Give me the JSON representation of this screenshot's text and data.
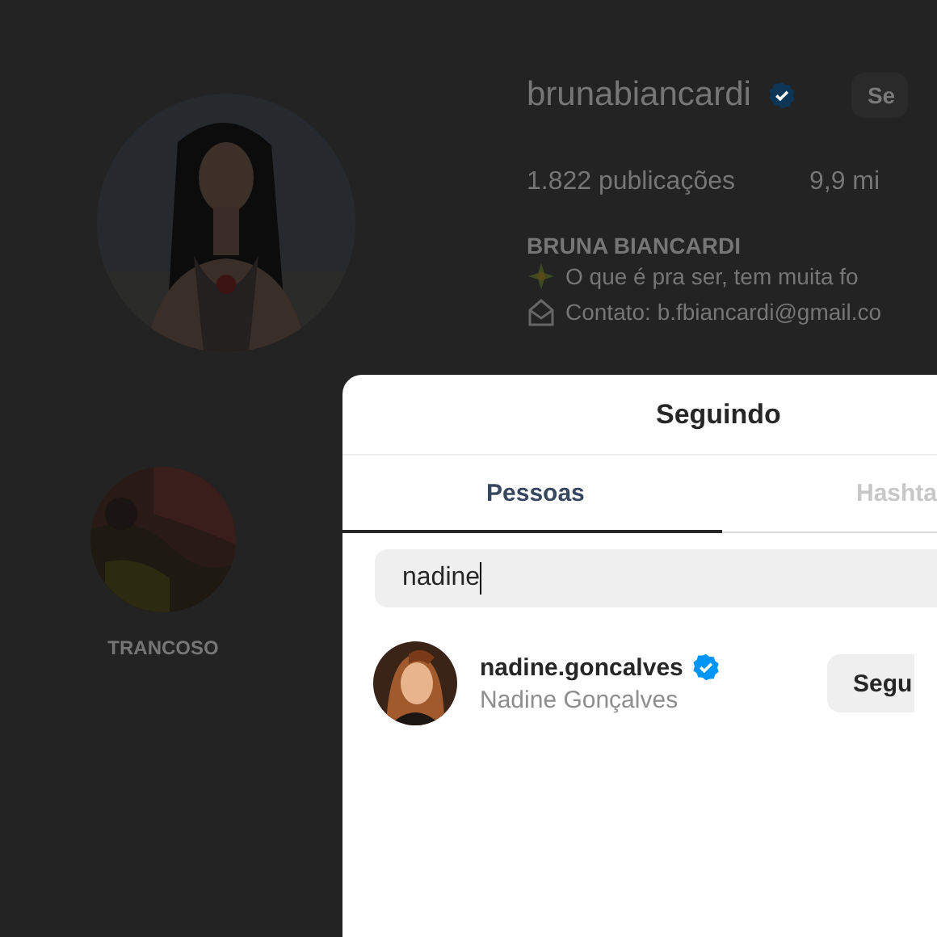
{
  "profile": {
    "username": "brunabiancardi",
    "verified": true,
    "action_button": "Se",
    "stats": [
      "1.822 publicações",
      "9,9 mi"
    ],
    "full_name": "BRUNA BIANCARDI",
    "bio_lines": [
      {
        "text": "O que é pra ser, tem muita fo"
      },
      {
        "text": "Contato: b.fbiancardi@gmail.co"
      }
    ],
    "highlights": [
      {
        "label": "TRANCOSO"
      }
    ]
  },
  "dialog": {
    "title": "Seguindo",
    "tabs": [
      {
        "label": "Pessoas",
        "selected": true
      },
      {
        "label": "Hashta",
        "selected": false
      }
    ],
    "search": {
      "value": "nadine"
    },
    "results": [
      {
        "username": "nadine.goncalves",
        "verified": true,
        "full_name": "Nadine Gonçalves",
        "button": "Segu"
      }
    ]
  }
}
